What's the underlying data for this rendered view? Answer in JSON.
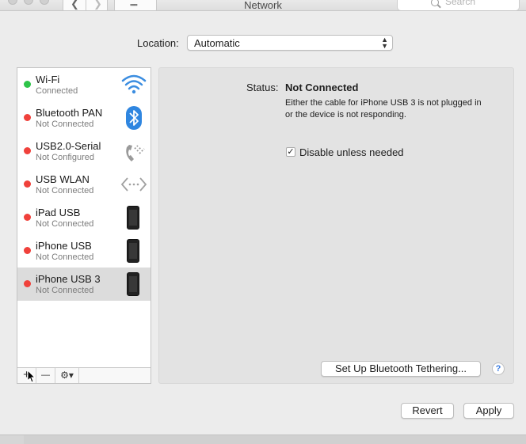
{
  "window": {
    "title": "Network"
  },
  "toolbar": {
    "search_placeholder": "Search"
  },
  "location": {
    "label": "Location:",
    "value": "Automatic"
  },
  "services": [
    {
      "name": "Wi-Fi",
      "status": "Connected",
      "status_color": "#2ec449",
      "icon": "wifi-icon"
    },
    {
      "name": "Bluetooth PAN",
      "status": "Not Connected",
      "status_color": "#f0413b",
      "icon": "bluetooth-icon"
    },
    {
      "name": "USB2.0-Serial",
      "status": "Not Configured",
      "status_color": "#f0413b",
      "icon": "phone-handset-icon"
    },
    {
      "name": "USB WLAN",
      "status": "Not Connected",
      "status_color": "#f0413b",
      "icon": "ethernet-arrows-icon"
    },
    {
      "name": "iPad USB",
      "status": "Not Connected",
      "status_color": "#f0413b",
      "icon": "iphone-icon"
    },
    {
      "name": "iPhone USB",
      "status": "Not Connected",
      "status_color": "#f0413b",
      "icon": "iphone-icon"
    },
    {
      "name": "iPhone USB 3",
      "status": "Not Connected",
      "status_color": "#f0413b",
      "icon": "iphone-icon",
      "selected": true
    }
  ],
  "sidebar_toolbar": {
    "add": "+",
    "remove": "—",
    "action": "⚙▾"
  },
  "detail": {
    "status_label": "Status:",
    "status_value": "Not Connected",
    "status_description": "Either the cable for iPhone USB 3 is not plugged in or the device is not responding.",
    "checkbox_checked": true,
    "checkbox_label": "Disable unless needed",
    "tethering_button": "Set Up Bluetooth Tethering...",
    "help": "?"
  },
  "buttons": {
    "revert": "Revert",
    "apply": "Apply"
  }
}
